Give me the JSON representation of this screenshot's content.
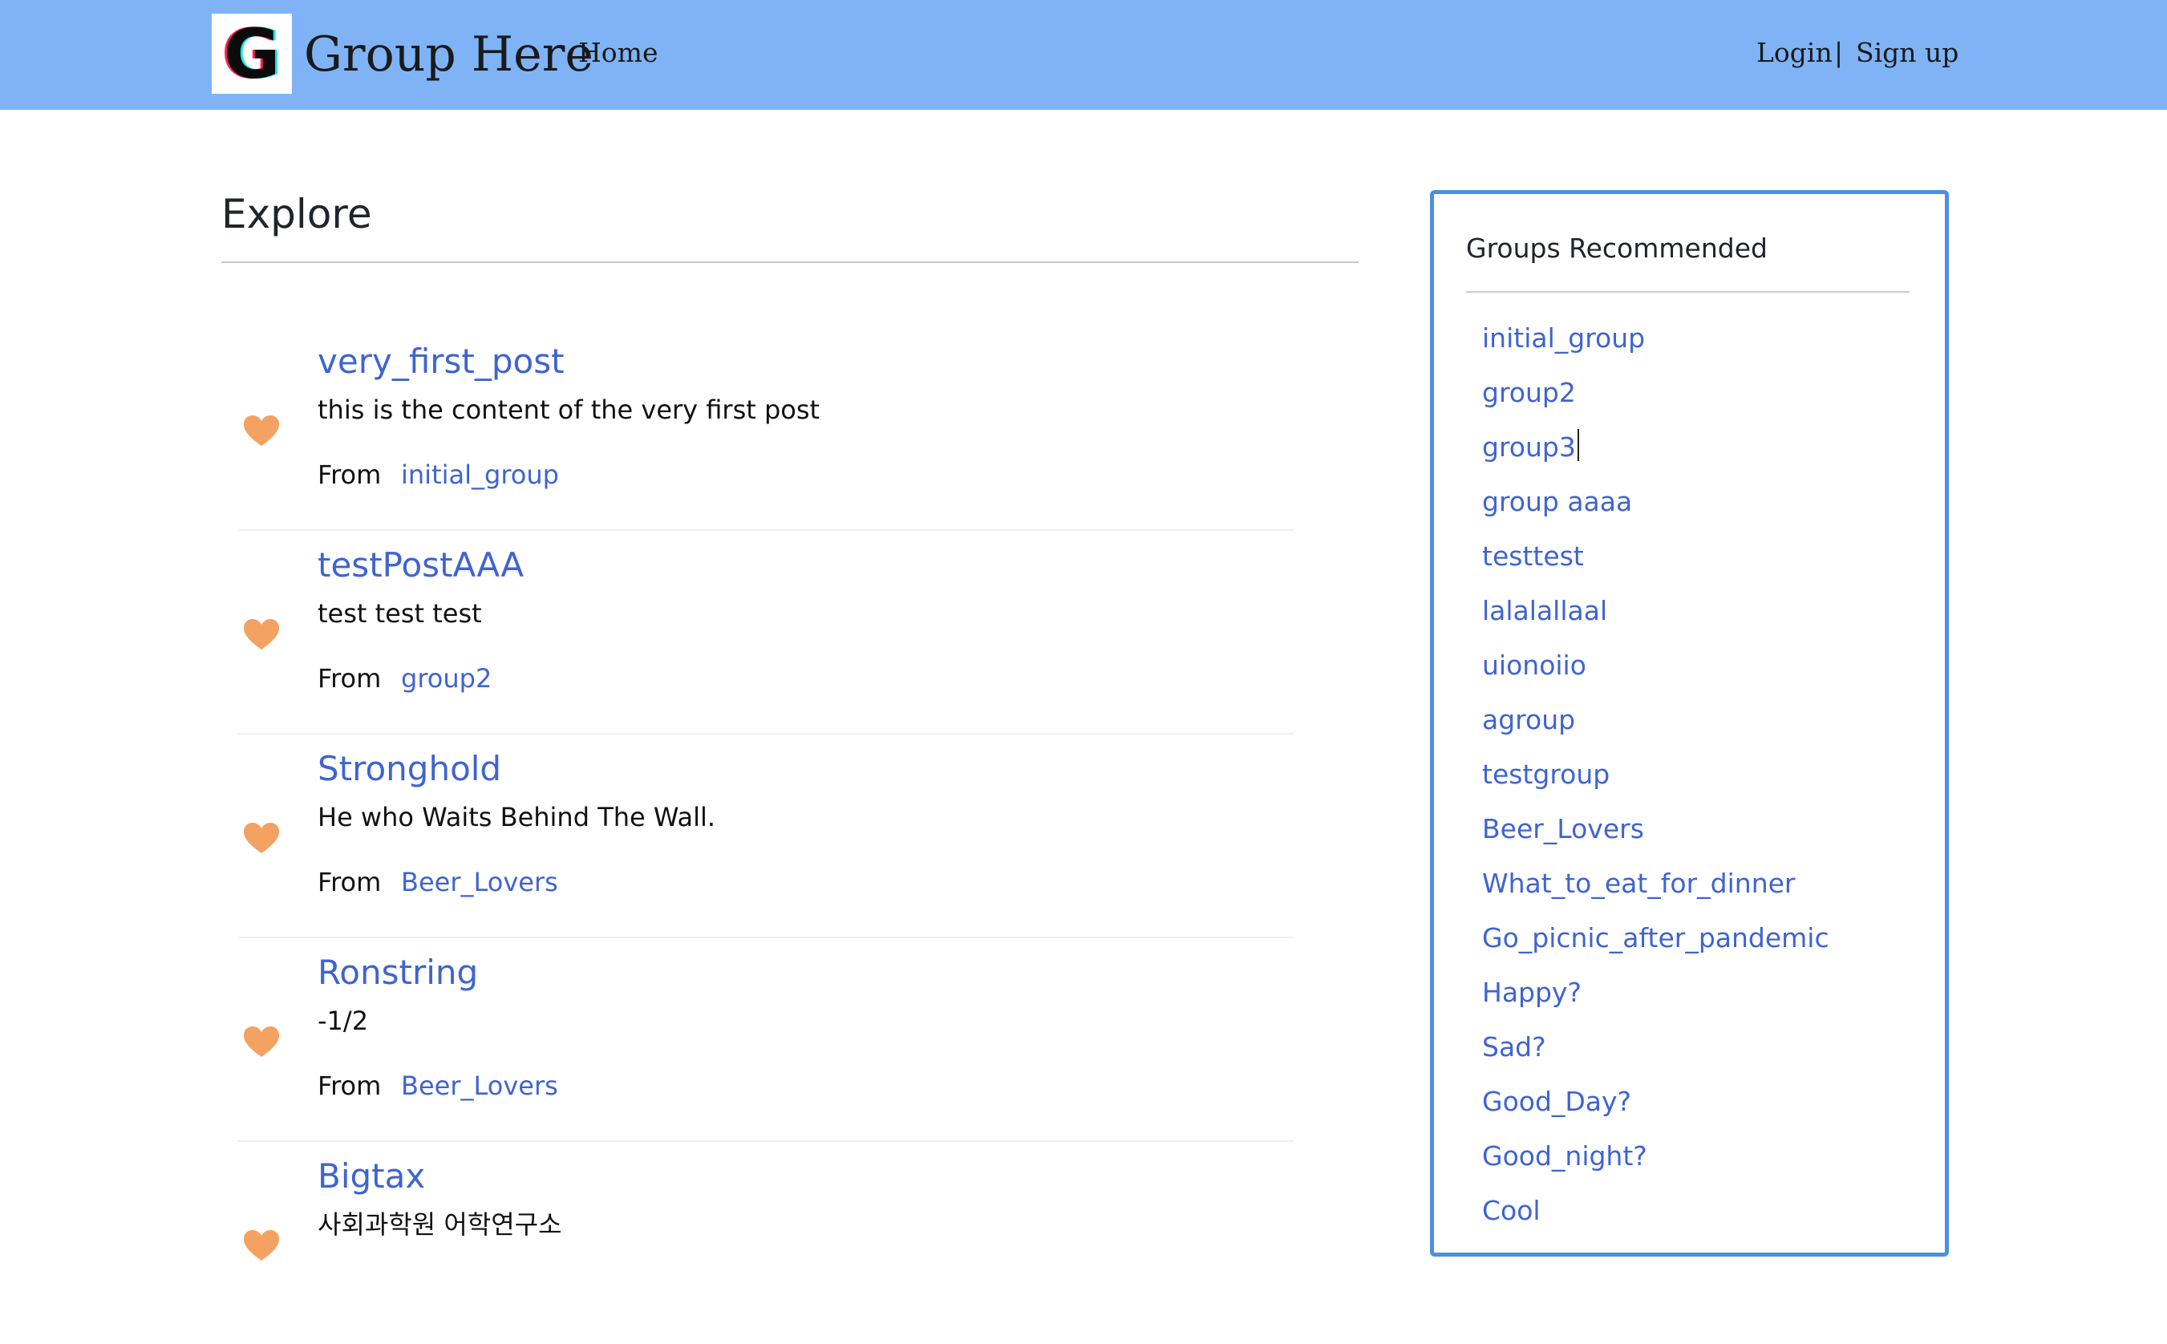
{
  "header": {
    "logo_letter": "G",
    "brand": "Group Here",
    "home_label": "Home",
    "login_label": "Login",
    "separator": "|",
    "signup_label": "Sign up",
    "background_color": "#7fb3f5"
  },
  "main": {
    "title": "Explore",
    "from_label": "From",
    "heart_icon": "heart-icon",
    "heart_color": "#f4a261",
    "link_color": "#3f64d0",
    "posts": [
      {
        "title": "very_first_post",
        "content": "this is the content of the very first post",
        "group": "initial_group"
      },
      {
        "title": "testPostAAA",
        "content": "test test test",
        "group": "group2"
      },
      {
        "title": "Stronghold",
        "content": "He who Waits Behind The Wall.",
        "group": "Beer_Lovers"
      },
      {
        "title": "Ronstring",
        "content": "-1/2",
        "group": "Beer_Lovers"
      },
      {
        "title": "Bigtax",
        "content": "사회과학원 어학연구소",
        "group": ""
      }
    ]
  },
  "sidebar": {
    "title": "Groups Recommended",
    "border_color": "#4a90e2",
    "groups": [
      "initial_group",
      "group2",
      "group3",
      "group aaaa",
      "testtest",
      "lalalallaal",
      "uionoiio",
      "agroup",
      "testgroup",
      "Beer_Lovers",
      "What_to_eat_for_dinner",
      "Go_picnic_after_pandemic",
      "Happy?",
      "Sad?",
      "Good_Day?",
      "Good_night?",
      "Cool"
    ]
  }
}
